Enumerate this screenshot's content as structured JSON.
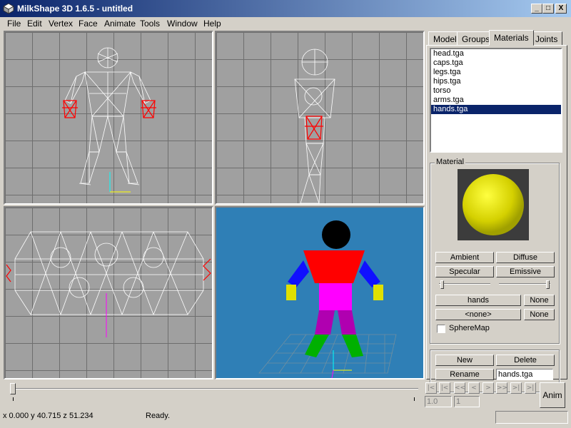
{
  "window": {
    "title": "MilkShape 3D 1.6.5 - untitled",
    "minimize": "_",
    "maximize": "□",
    "close": "X"
  },
  "menu": [
    "File",
    "Edit",
    "Vertex",
    "Face",
    "Animate",
    "Tools",
    "Window",
    "Help"
  ],
  "tabs": [
    "Model",
    "Groups",
    "Materials",
    "Joints"
  ],
  "active_tab": "Materials",
  "materials": {
    "list": [
      "head.tga",
      "caps.tga",
      "legs.tga",
      "hips.tga",
      "torso",
      "arms.tga",
      "hands.tga"
    ],
    "selected": "hands.tga",
    "group_label": "Material",
    "preview_color": "#d4d000",
    "buttons": {
      "ambient": "Ambient",
      "diffuse": "Diffuse",
      "specular": "Specular",
      "emissive": "Emissive"
    },
    "texture1": "hands",
    "texture1_none": "None",
    "texture2": "<none>",
    "texture2_none": "None",
    "spheremap": "SphereMap",
    "spheremap_checked": false,
    "new": "New",
    "delete": "Delete",
    "rename": "Rename",
    "name_value": "hands.tga"
  },
  "animation": {
    "nav": [
      "|<",
      "|<",
      "<<",
      "<",
      ">",
      ">>",
      ">|",
      ">|"
    ],
    "frame_start": "1.0",
    "frame_end": "1",
    "anim_button": "Anim",
    "slider_fraction": 0.0
  },
  "status": {
    "coords": "x 0.000 y 40.715 z 51.234",
    "message": "Ready."
  },
  "colors": {
    "accent": "#0a246a",
    "wire": "#ffffff",
    "selected_wire": "#ff0000",
    "viewport_bg": "#a0a0a0",
    "render_bg": "#2f7fb6"
  }
}
